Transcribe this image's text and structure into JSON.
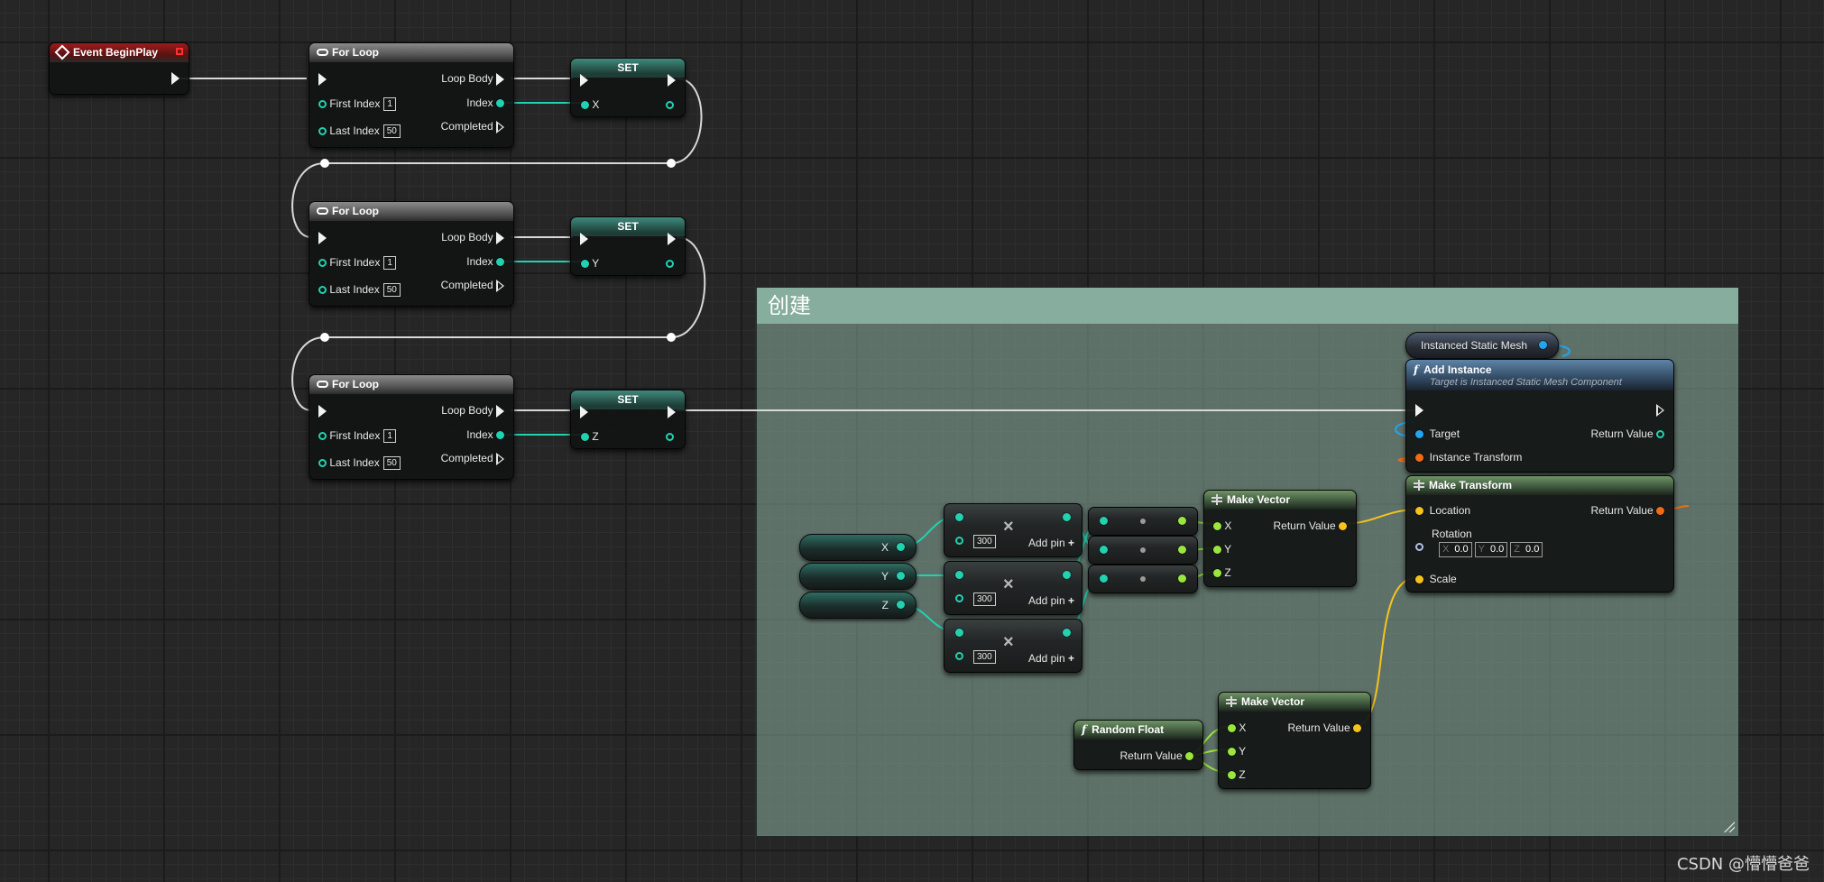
{
  "event_begin_play": {
    "title": "Event BeginPlay"
  },
  "for_loops": [
    {
      "title": "For Loop",
      "loop_body": "Loop Body",
      "first_index_label": "First Index",
      "first_index_value": "1",
      "index": "Index",
      "last_index_label": "Last Index",
      "last_index_value": "50",
      "completed": "Completed"
    },
    {
      "title": "For Loop",
      "loop_body": "Loop Body",
      "first_index_label": "First Index",
      "first_index_value": "1",
      "index": "Index",
      "last_index_label": "Last Index",
      "last_index_value": "50",
      "completed": "Completed"
    },
    {
      "title": "For Loop",
      "loop_body": "Loop Body",
      "first_index_label": "First Index",
      "first_index_value": "1",
      "index": "Index",
      "last_index_label": "Last Index",
      "last_index_value": "50",
      "completed": "Completed"
    }
  ],
  "set_nodes": [
    {
      "title": "SET",
      "var": "X"
    },
    {
      "title": "SET",
      "var": "Y"
    },
    {
      "title": "SET",
      "var": "Z"
    }
  ],
  "comment": {
    "title": "创建"
  },
  "get_vars": [
    "X",
    "Y",
    "Z"
  ],
  "multiply_nodes": [
    {
      "value": "300",
      "add_pin": "Add pin"
    },
    {
      "value": "300",
      "add_pin": "Add pin"
    },
    {
      "value": "300",
      "add_pin": "Add pin"
    }
  ],
  "make_vector_1": {
    "title": "Make Vector",
    "x": "X",
    "y": "Y",
    "z": "Z",
    "return_value": "Return Value"
  },
  "ism_var": {
    "label": "Instanced Static Mesh"
  },
  "add_instance": {
    "title": "Add Instance",
    "subtitle": "Target is Instanced Static Mesh Component",
    "target": "Target",
    "return_value": "Return Value",
    "instance_transform": "Instance Transform"
  },
  "make_transform": {
    "title": "Make Transform",
    "location": "Location",
    "return_value": "Return Value",
    "rotation": "Rotation",
    "rot_x_label": "X",
    "rot_x": "0.0",
    "rot_y_label": "Y",
    "rot_y": "0.0",
    "rot_z_label": "Z",
    "rot_z": "0.0",
    "scale": "Scale"
  },
  "random_float": {
    "title": "Random Float",
    "return_value": "Return Value"
  },
  "make_vector_2": {
    "title": "Make Vector",
    "x": "X",
    "y": "Y",
    "z": "Z",
    "return_value": "Return Value"
  },
  "watermark": "CSDN @懵懵爸爸",
  "colors": {
    "float_pin": "#9ae63c",
    "int_pin": "#21d2b0",
    "vector_pin": "#f5c31c",
    "transform_pin": "#f06b14",
    "object_pin": "#21a5f0",
    "exec_wire": "#d8d8d8"
  }
}
